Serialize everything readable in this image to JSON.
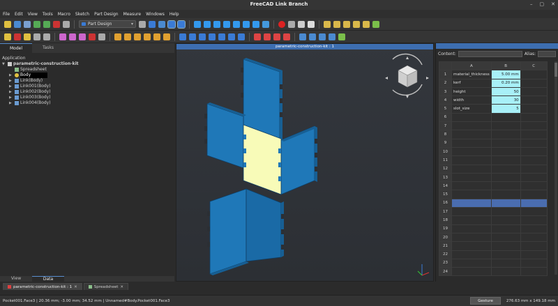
{
  "window": {
    "title": "FreeCAD Link Branch"
  },
  "menu": [
    "File",
    "Edit",
    "View",
    "Tools",
    "Macro",
    "Sketch",
    "Part Design",
    "Measure",
    "Windows",
    "Help"
  ],
  "toolbar": {
    "workbench": "Part Design"
  },
  "combo": {
    "tabs": [
      "Model",
      "Tasks"
    ],
    "bottom_tabs": [
      "View",
      "Data"
    ],
    "section_label": "Application",
    "tree": [
      {
        "label": "parametric-construction-kit",
        "level": 0,
        "icon": "document-icon",
        "bold": true
      },
      {
        "label": "Spreadsheet",
        "level": 1,
        "icon": "spreadsheet-icon"
      },
      {
        "label": "Body",
        "level": 1,
        "icon": "body-icon",
        "selected": true
      },
      {
        "label": "Link(Body)",
        "level": 1,
        "icon": "link-icon"
      },
      {
        "label": "Link001(Body)",
        "level": 1,
        "icon": "link-icon"
      },
      {
        "label": "Link002(Body)",
        "level": 1,
        "icon": "link-icon"
      },
      {
        "label": "Link003(Body)",
        "level": 1,
        "icon": "link-icon"
      },
      {
        "label": "Link004(Body)",
        "level": 1,
        "icon": "link-icon"
      }
    ]
  },
  "view3d": {
    "title": "parametric-construction-kit : 1"
  },
  "spreadsheet": {
    "content_label": "Content:",
    "alias_label": "Alias:",
    "columns": [
      "A",
      "B",
      "C"
    ],
    "rows": [
      {
        "n": "1",
        "a": "material_thickness",
        "b": "5.00 mm"
      },
      {
        "n": "2",
        "a": "kerf",
        "b": "0.20 mm"
      },
      {
        "n": "3",
        "a": "height",
        "b": "50"
      },
      {
        "n": "4",
        "a": "width",
        "b": "30"
      },
      {
        "n": "5",
        "a": "slot_size",
        "b": "5"
      },
      {
        "n": "6",
        "a": "",
        "b": ""
      },
      {
        "n": "7",
        "a": "",
        "b": ""
      },
      {
        "n": "8",
        "a": "",
        "b": ""
      },
      {
        "n": "9",
        "a": "",
        "b": ""
      },
      {
        "n": "10",
        "a": "",
        "b": ""
      },
      {
        "n": "11",
        "a": "",
        "b": ""
      },
      {
        "n": "12",
        "a": "",
        "b": ""
      },
      {
        "n": "13",
        "a": "",
        "b": ""
      },
      {
        "n": "14",
        "a": "",
        "b": ""
      },
      {
        "n": "15",
        "a": "",
        "b": ""
      },
      {
        "n": "16",
        "a": "",
        "b": ""
      },
      {
        "n": "17",
        "a": "",
        "b": ""
      },
      {
        "n": "18",
        "a": "",
        "b": ""
      },
      {
        "n": "19",
        "a": "",
        "b": ""
      },
      {
        "n": "20",
        "a": "",
        "b": ""
      },
      {
        "n": "21",
        "a": "",
        "b": ""
      },
      {
        "n": "22",
        "a": "",
        "b": ""
      },
      {
        "n": "23",
        "a": "",
        "b": ""
      },
      {
        "n": "24",
        "a": "",
        "b": ""
      }
    ],
    "selected_row": "16"
  },
  "doc_tabs": [
    {
      "label": "parametric-construction-kit : 1",
      "active": true
    },
    {
      "label": "Spreadsheet",
      "active": false
    }
  ],
  "status": {
    "text": "Pocket001.Face3 | 20.36 mm; -3.00 mm; 34.52 mm | Unnamed#Body.Pocket001.Face3",
    "nav_style": "Gesture",
    "dimensions": "276.63 mm x 149.18 mm"
  },
  "colors": {
    "part_blue": "#1f78b8",
    "part_blue_dark": "#175f94",
    "selected_face": "#f8fbb8",
    "title_blue": "#3d6eb0",
    "cell_highlight": "#a8f0f8"
  }
}
